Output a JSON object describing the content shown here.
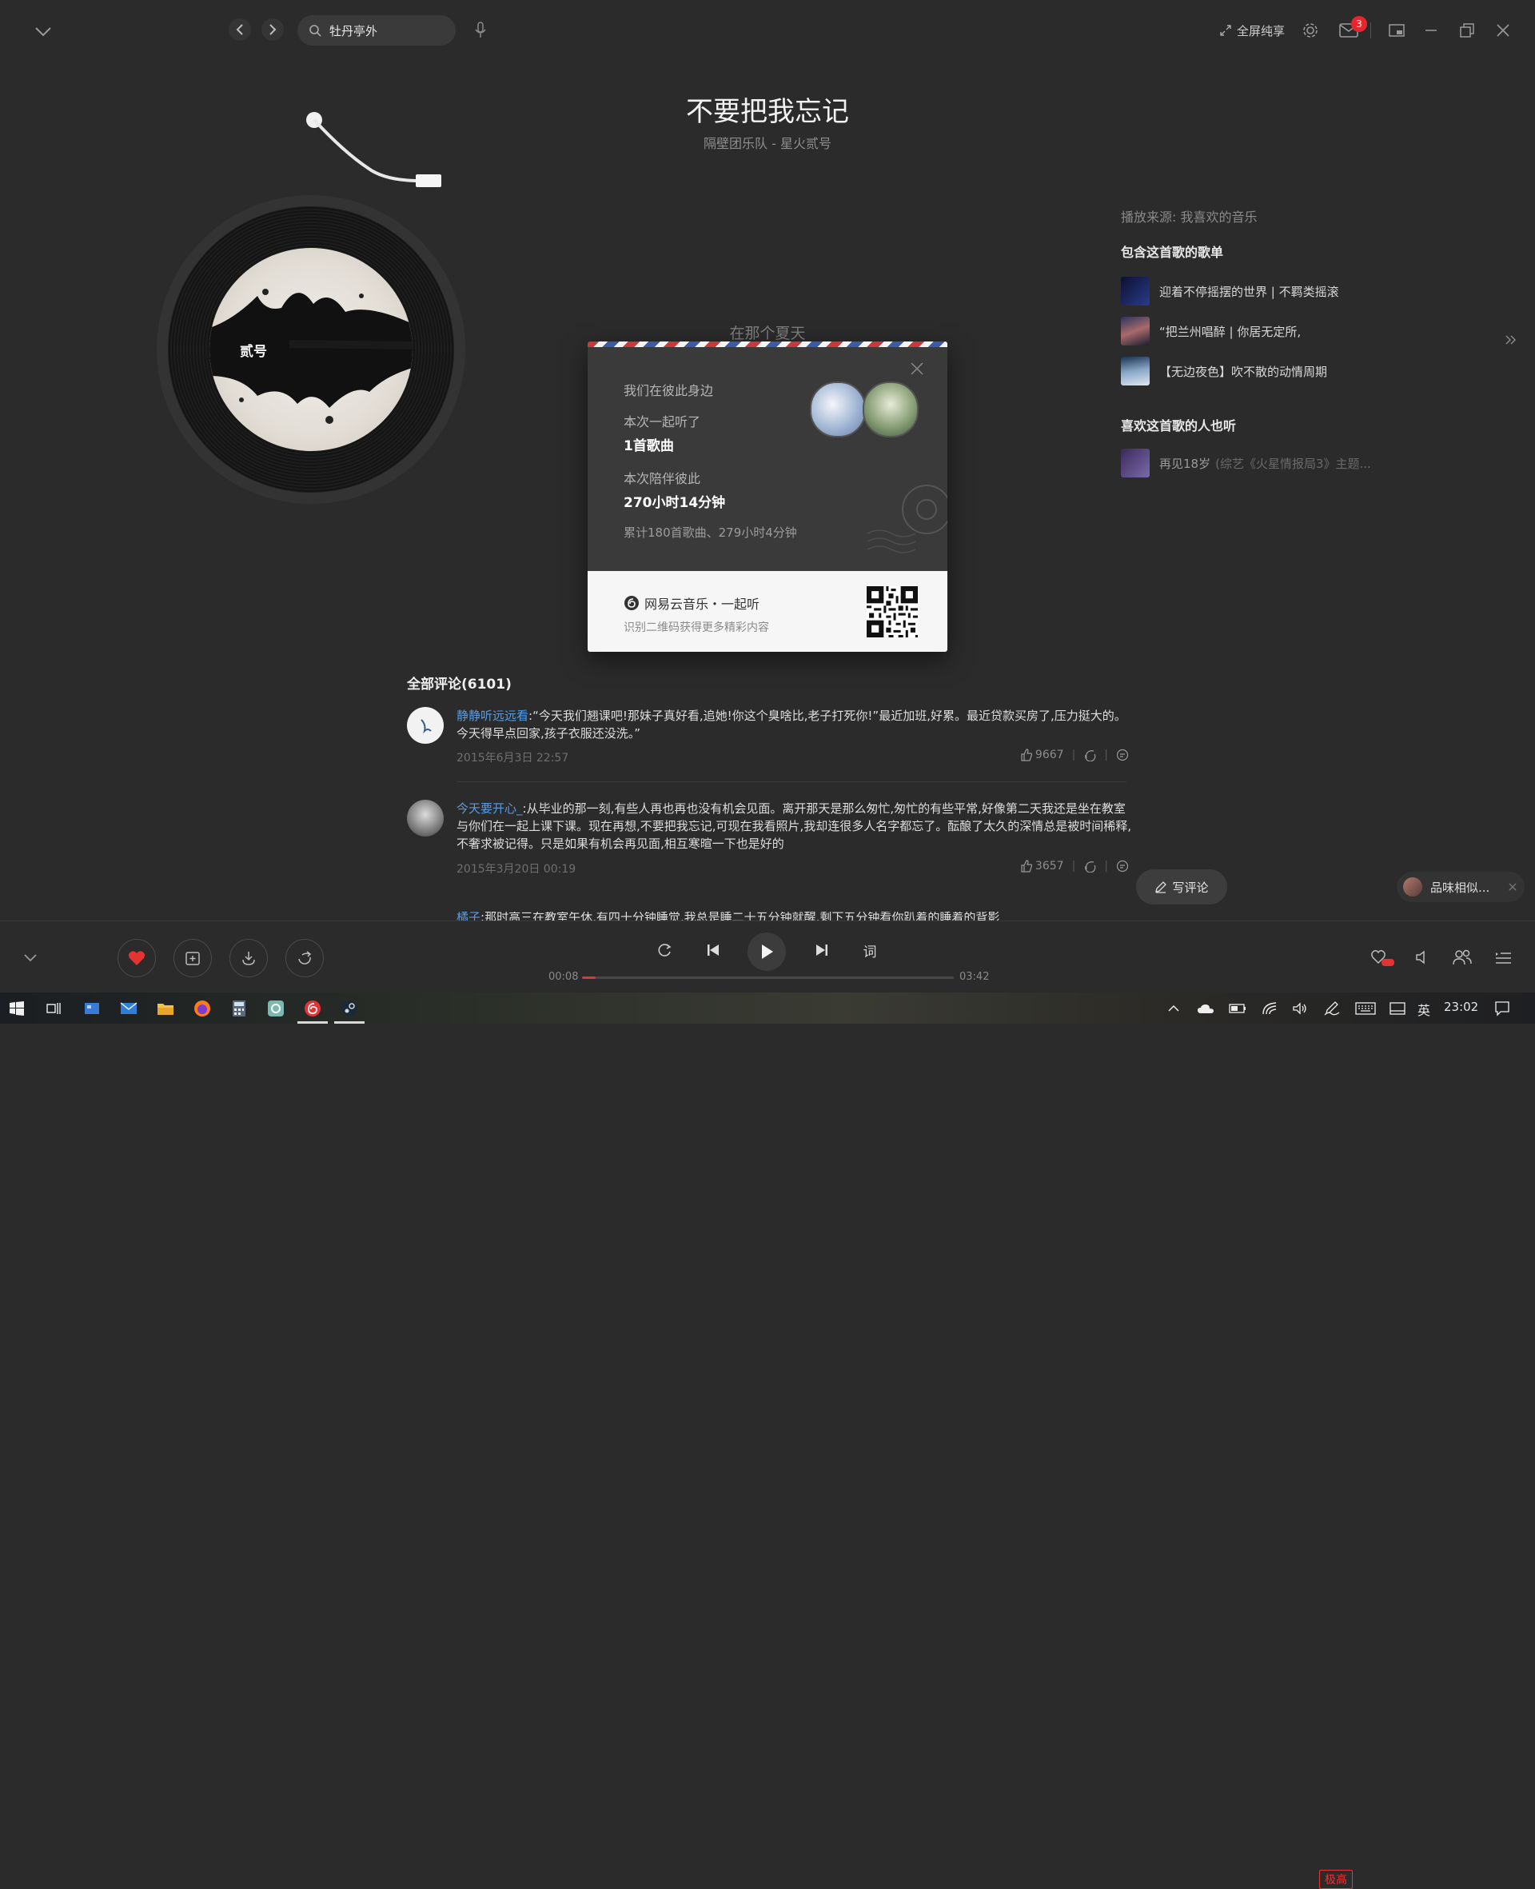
{
  "search": {
    "query": "牡丹亭外"
  },
  "topbar": {
    "fullscreen_share_label": "全屏纯享",
    "mail_badge": "3"
  },
  "song": {
    "title": "不要把我忘记",
    "subtitle": "隔壁团乐队 - 星火贰号"
  },
  "record": {
    "label_text": "贰号"
  },
  "lyric": {
    "current_line": "在那个夏天"
  },
  "right_panel": {
    "source": "播放来源: 我喜欢的音乐",
    "playlists_heading": "包含这首歌的歌单",
    "playlists": [
      {
        "name": "迎着不停摇摆的世界 | 不羁类摇滚",
        "color": "#1c2a5a"
      },
      {
        "name": "“把兰州唱醉 | 你居无定所,",
        "color": "#7a4a5a"
      },
      {
        "name": "【无边夜色】吹不散的动情周期",
        "color": "#4c6c8c"
      }
    ],
    "also_listen_heading": "喜欢这首歌的人也听",
    "also_listen": [
      {
        "title": "再见18岁",
        "meta": "(综艺《火星情报局3》主题...",
        "color": "#5a4a7a"
      }
    ]
  },
  "modal": {
    "together_label": "我们在彼此身边",
    "listened_label": "本次一起听了",
    "listened_value": "1首歌曲",
    "accompany_label": "本次陪伴彼此",
    "accompany_value": "270小时14分钟",
    "total_text": "累计180首歌曲、279小时4分钟",
    "brand": "网易云音乐・一起听",
    "qr_hint": "识别二维码获得更多精彩内容"
  },
  "comments": {
    "heading": "全部评论(6101)",
    "items": [
      {
        "user": "静静听远远看",
        "text": ":“今天我们翘课吧!那妹子真好看,追她!你这个臭啥比,老子打死你!”最近加班,好累。最近贷款买房了,压力挺大的。今天得早点回家,孩子衣服还没洗。”",
        "time": "2015年6月3日 22:57",
        "likes": "9667"
      },
      {
        "user": "今天要开心_",
        "text": ":从毕业的那一刻,有些人再也再也没有机会见面。离开那天是那么匆忙,匆忙的有些平常,好像第二天我还是坐在教室与你们在一起上课下课。现在再想,不要把我忘记,可现在我看照片,我却连很多人名字都忘了。酝酿了太久的深情总是被时间稀释,不奢求被记得。只是如果有机会再见面,相互寒暄一下也是好的",
        "time": "2015年3月20日 00:19",
        "likes": "3657"
      },
      {
        "user": "橘子",
        "text": ":那时高三在教室午休,有四十分钟睡觉,我总是睡二十五分钟就醒,剩下五分钟看你趴着的睡着的背影"
      }
    ],
    "write_label": "写评论",
    "taste_label": "品味相似..."
  },
  "player": {
    "elapsed": "00:08",
    "duration": "03:42",
    "progress": 0.036,
    "quality": "极高",
    "lyric_btn": "词",
    "accent": "#e33333"
  },
  "taskbar": {
    "ime": "英",
    "clock": "23:02"
  }
}
